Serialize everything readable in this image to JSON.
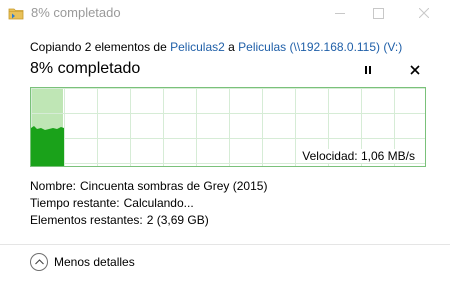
{
  "window": {
    "title": "8% completado",
    "icons": {
      "app": "folder-copy-icon",
      "minimize": "minimize-icon",
      "maximize": "maximize-icon",
      "close": "close-icon"
    }
  },
  "copy": {
    "prefix": "Copiando 2 elementos de ",
    "source": "Peliculas2",
    "connector": " a ",
    "destination": "Peliculas (\\\\192.168.0.115) (V:)"
  },
  "progress": {
    "title": "8% completado",
    "percent": 8,
    "speed": "Velocidad: 1,06 MB/s",
    "pause_icon": "pause-icon",
    "cancel_icon": "close-icon"
  },
  "details": [
    {
      "key": "Nombre:",
      "value": "Cincuenta sombras de Grey (2015)"
    },
    {
      "key": "Tiempo restante:",
      "value": "Calculando..."
    },
    {
      "key": "Elementos restantes:",
      "value": "2 (3,69 GB)"
    }
  ],
  "footer": {
    "less_details": "Menos detalles",
    "chevron_icon": "chevron-up-icon"
  },
  "colors": {
    "graph_border": "#7ac17a",
    "graph_progress": "#bfe6b5",
    "graph_speed": "#1aa21a",
    "link": "#1f5fa8"
  }
}
